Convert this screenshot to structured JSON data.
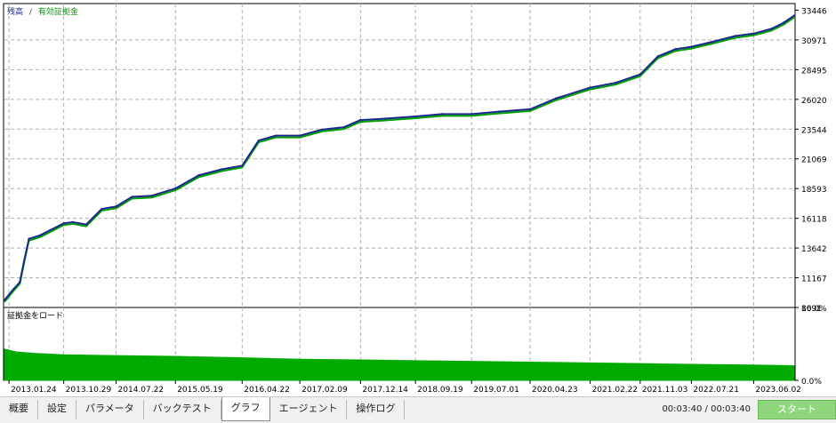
{
  "chart_data": [
    {
      "type": "line",
      "legend": [
        {
          "name": "残高",
          "color": "#1a2a8c"
        },
        {
          "name": "有効証拠金",
          "color": "#00a000"
        }
      ],
      "legend_separator": "/",
      "y_ticks": [
        "33446",
        "30971",
        "28495",
        "26020",
        "23544",
        "21069",
        "18593",
        "16118",
        "13642",
        "11167",
        "8691"
      ],
      "ylim": [
        8691,
        34000
      ],
      "x_ticks": [
        "2013.01.24",
        "2013.10.29",
        "2014.07.22",
        "2015.05.19",
        "2016.04.22",
        "2017.02.09",
        "2017.12.14",
        "2018.09.19",
        "2019.07.01",
        "2020.04.23",
        "2021.02.22",
        "2021.11.03",
        "2022.07.21",
        "2023.06.02"
      ],
      "series": [
        {
          "name": "残高",
          "color": "#1a2a8c",
          "x": [
            "2013.01.01",
            "2013.02.15",
            "2013.03.20",
            "2013.04.10",
            "2013.05.05",
            "2013.07.01",
            "2013.10.29",
            "2013.12.15",
            "2014.02.20",
            "2014.05.10",
            "2014.07.22",
            "2014.10.10",
            "2015.01.20",
            "2015.05.19",
            "2015.09.15",
            "2016.01.10",
            "2016.04.22",
            "2016.07.15",
            "2016.10.10",
            "2017.02.09",
            "2017.06.01",
            "2017.09.20",
            "2017.12.14",
            "2018.04.01",
            "2018.09.19",
            "2019.02.01",
            "2019.07.01",
            "2019.11.15",
            "2020.04.23",
            "2020.09.01",
            "2021.02.22",
            "2021.07.01",
            "2021.11.03",
            "2022.02.01",
            "2022.05.01",
            "2022.07.21",
            "2022.11.01",
            "2023.03.01",
            "2023.06.02",
            "2023.09.01",
            "2023.11.01",
            "2023.12.25"
          ],
          "values": [
            9300,
            10200,
            10800,
            12500,
            14400,
            14700,
            15700,
            15800,
            15600,
            16900,
            17100,
            17900,
            18000,
            18600,
            19700,
            20200,
            20500,
            22600,
            23000,
            23000,
            23500,
            23700,
            24300,
            24400,
            24600,
            24800,
            24800,
            25000,
            25200,
            26100,
            27000,
            27400,
            28100,
            29600,
            30200,
            30400,
            30800,
            31300,
            31500,
            31900,
            32400,
            33000
          ]
        }
      ]
    },
    {
      "type": "area",
      "title": "証拠金をロード",
      "y_ticks": [
        "10.0%",
        "0.0%"
      ],
      "ylim": [
        0,
        10
      ],
      "color": "#00aa00",
      "x": [
        "2013.01.01",
        "2013.03.01",
        "2013.06.01",
        "2013.10.29",
        "2014.07.22",
        "2015.05.19",
        "2016.04.22",
        "2017.02.09",
        "2017.12.14",
        "2018.09.19",
        "2019.07.01",
        "2020.04.23",
        "2021.02.22",
        "2021.11.03",
        "2022.07.21",
        "2023.06.02",
        "2023.12.25"
      ],
      "values": [
        4.3,
        3.9,
        3.7,
        3.5,
        3.4,
        3.3,
        3.1,
        2.9,
        2.8,
        2.7,
        2.6,
        2.5,
        2.4,
        2.3,
        2.2,
        2.1,
        2.0
      ]
    }
  ],
  "tabs": [
    "概要",
    "設定",
    "パラメータ",
    "バックテスト",
    "グラフ",
    "エージェント",
    "操作ログ"
  ],
  "active_tab": 4,
  "timer": "00:03:40 / 00:03:40",
  "start_label": "スタート"
}
